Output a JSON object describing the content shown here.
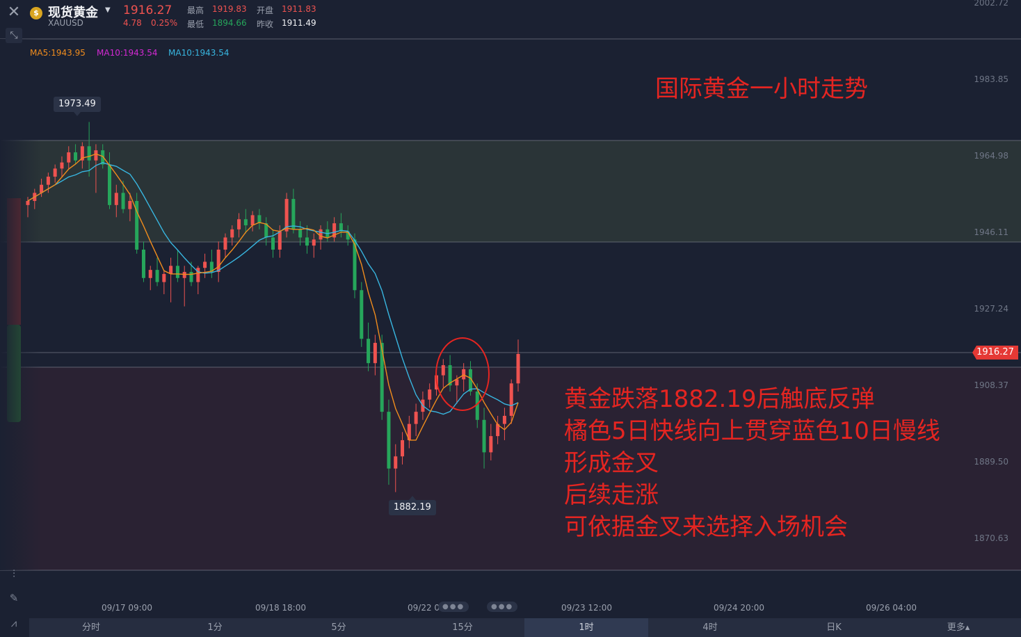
{
  "header": {
    "symbol_name": "现货黄金",
    "symbol_code": "XAUUSD",
    "coin_glyph": "$",
    "price": "1916.27",
    "change": "4.78",
    "change_pct": "0.25%",
    "high_label": "最高",
    "high": "1919.83",
    "low_label": "最低",
    "low": "1894.66",
    "open_label": "开盘",
    "open": "1911.83",
    "prev_close_label": "昨收",
    "prev_close": "1911.49"
  },
  "ma_legend": [
    {
      "text": "MA5:1943.95",
      "color": "#f08c1d"
    },
    {
      "text": "MA10:1943.54",
      "color": "#d329d3"
    },
    {
      "text": "MA10:1943.54",
      "color": "#38b6e0"
    }
  ],
  "annotations": {
    "title": "国际黄金一小时走势",
    "lines": [
      "黄金跌落1882.19后触底反弹",
      "橘色5日快线向上贯穿蓝色10日慢线",
      "形成金叉",
      "后续走涨",
      "可依据金叉来选择入场机会"
    ]
  },
  "current_price_tag": "1916.27",
  "tabs": [
    {
      "label": "分时",
      "active": false
    },
    {
      "label": "1分",
      "active": false
    },
    {
      "label": "5分",
      "active": false
    },
    {
      "label": "15分",
      "active": false
    },
    {
      "label": "1时",
      "active": true
    },
    {
      "label": "4时",
      "active": false
    },
    {
      "label": "日K",
      "active": false
    },
    {
      "label": "更多▴",
      "active": false
    }
  ],
  "icons": {
    "close": "close-icon",
    "expand": "expand-icon",
    "indicator": "indicator-icon",
    "draw": "pencil-icon",
    "compare": "chart-line-icon"
  },
  "chart_data": {
    "type": "candlestick",
    "title": "",
    "y_ticks": [
      "2002.72",
      "1983.85",
      "1964.98",
      "1946.11",
      "1927.24",
      "1908.37",
      "1889.50",
      "1870.63"
    ],
    "x_ticks": [
      "09/17 09:00",
      "09/18 18:00",
      "09/22 00:00",
      "09/23 12:00",
      "09/24 20:00",
      "09/26 04:00"
    ],
    "ylim": [
      1862.0,
      2002.72
    ],
    "max_label": "1973.49",
    "min_label": "1882.19",
    "ma_colors": {
      "ma5": "#f08c1d",
      "ma10": "#38b6e0"
    },
    "candles": [
      [
        1953.0,
        1955.0,
        1950.0,
        1954.0
      ],
      [
        1954.0,
        1957.0,
        1952.0,
        1956.0
      ],
      [
        1956.0,
        1959.5,
        1955.0,
        1958.0
      ],
      [
        1958.0,
        1961.0,
        1956.0,
        1960.0
      ],
      [
        1960.0,
        1963.0,
        1958.5,
        1962.0
      ],
      [
        1962.0,
        1965.0,
        1960.0,
        1963.5
      ],
      [
        1963.5,
        1967.5,
        1962.0,
        1966.0
      ],
      [
        1966.0,
        1968.0,
        1963.0,
        1964.0
      ],
      [
        1964.0,
        1968.5,
        1962.0,
        1967.5
      ],
      [
        1967.5,
        1973.49,
        1960.0,
        1964.0
      ],
      [
        1964.0,
        1968.0,
        1956.0,
        1966.5
      ],
      [
        1966.5,
        1968.0,
        1962.0,
        1963.0
      ],
      [
        1963.0,
        1966.0,
        1952.0,
        1953.0
      ],
      [
        1953.0,
        1958.0,
        1950.0,
        1956.0
      ],
      [
        1956.0,
        1959.0,
        1951.0,
        1952.0
      ],
      [
        1952.0,
        1956.0,
        1949.0,
        1954.0
      ],
      [
        1954.0,
        1956.0,
        1941.0,
        1942.0
      ],
      [
        1942.0,
        1944.0,
        1934.0,
        1935.0
      ],
      [
        1935.0,
        1938.0,
        1932.0,
        1937.0
      ],
      [
        1937.0,
        1940.0,
        1933.0,
        1934.0
      ],
      [
        1934.0,
        1937.0,
        1931.0,
        1936.0
      ],
      [
        1936.0,
        1940.0,
        1929.0,
        1938.0
      ],
      [
        1938.0,
        1942.0,
        1934.0,
        1935.0
      ],
      [
        1935.0,
        1938.0,
        1928.0,
        1936.5
      ],
      [
        1936.5,
        1939.0,
        1933.0,
        1934.0
      ],
      [
        1934.0,
        1938.0,
        1931.0,
        1937.5
      ],
      [
        1937.5,
        1941.0,
        1935.0,
        1939.0
      ],
      [
        1939.0,
        1942.0,
        1935.0,
        1936.5
      ],
      [
        1936.5,
        1944.0,
        1934.0,
        1942.0
      ],
      [
        1942.0,
        1946.0,
        1940.0,
        1945.0
      ],
      [
        1945.0,
        1948.0,
        1943.0,
        1947.0
      ],
      [
        1947.0,
        1951.0,
        1945.0,
        1949.5
      ],
      [
        1949.5,
        1952.0,
        1946.0,
        1948.0
      ],
      [
        1948.0,
        1951.5,
        1946.5,
        1950.5
      ],
      [
        1950.5,
        1952.0,
        1947.0,
        1948.5
      ],
      [
        1948.5,
        1950.0,
        1943.0,
        1945.0
      ],
      [
        1945.0,
        1947.0,
        1940.0,
        1942.0
      ],
      [
        1942.0,
        1948.0,
        1940.0,
        1946.5
      ],
      [
        1946.5,
        1956.0,
        1945.0,
        1954.5
      ],
      [
        1954.5,
        1957.0,
        1946.0,
        1947.0
      ],
      [
        1947.0,
        1949.0,
        1943.0,
        1945.0
      ],
      [
        1945.0,
        1948.0,
        1941.0,
        1943.0
      ],
      [
        1943.0,
        1946.0,
        1940.0,
        1944.5
      ],
      [
        1944.5,
        1948.0,
        1942.0,
        1947.0
      ],
      [
        1947.0,
        1949.0,
        1944.0,
        1945.0
      ],
      [
        1945.0,
        1950.0,
        1944.0,
        1948.5
      ],
      [
        1948.5,
        1951.0,
        1945.0,
        1946.5
      ],
      [
        1946.5,
        1948.0,
        1943.0,
        1944.5
      ],
      [
        1944.5,
        1946.0,
        1930.0,
        1932.0
      ],
      [
        1932.0,
        1934.0,
        1918.0,
        1920.0
      ],
      [
        1920.0,
        1924.0,
        1912.0,
        1914.0
      ],
      [
        1914.0,
        1921.0,
        1911.0,
        1919.0
      ],
      [
        1919.0,
        1921.0,
        1900.0,
        1902.0
      ],
      [
        1902.0,
        1905.0,
        1884.0,
        1888.0
      ],
      [
        1888.0,
        1894.0,
        1882.19,
        1891.0
      ],
      [
        1891.0,
        1897.0,
        1889.0,
        1895.0
      ],
      [
        1895.0,
        1901.0,
        1893.0,
        1899.0
      ],
      [
        1899.0,
        1904.0,
        1896.0,
        1902.0
      ],
      [
        1902.0,
        1907.0,
        1900.0,
        1905.0
      ],
      [
        1905.0,
        1909.0,
        1903.0,
        1907.5
      ],
      [
        1907.5,
        1913.0,
        1906.0,
        1911.0
      ],
      [
        1911.0,
        1915.0,
        1908.0,
        1913.5
      ],
      [
        1913.5,
        1916.0,
        1907.0,
        1908.5
      ],
      [
        1908.5,
        1911.0,
        1904.0,
        1910.0
      ],
      [
        1910.0,
        1914.0,
        1907.0,
        1912.5
      ],
      [
        1912.5,
        1914.5,
        1906.0,
        1907.0
      ],
      [
        1907.0,
        1909.0,
        1898.0,
        1900.0
      ],
      [
        1900.0,
        1903.0,
        1888.0,
        1892.0
      ],
      [
        1892.0,
        1899.0,
        1890.0,
        1896.0
      ],
      [
        1896.0,
        1901.0,
        1894.0,
        1899.0
      ],
      [
        1899.0,
        1903.0,
        1895.0,
        1901.0
      ],
      [
        1901.0,
        1910.0,
        1899.0,
        1909.0
      ],
      [
        1909.0,
        1919.83,
        1907.0,
        1916.27
      ]
    ]
  }
}
